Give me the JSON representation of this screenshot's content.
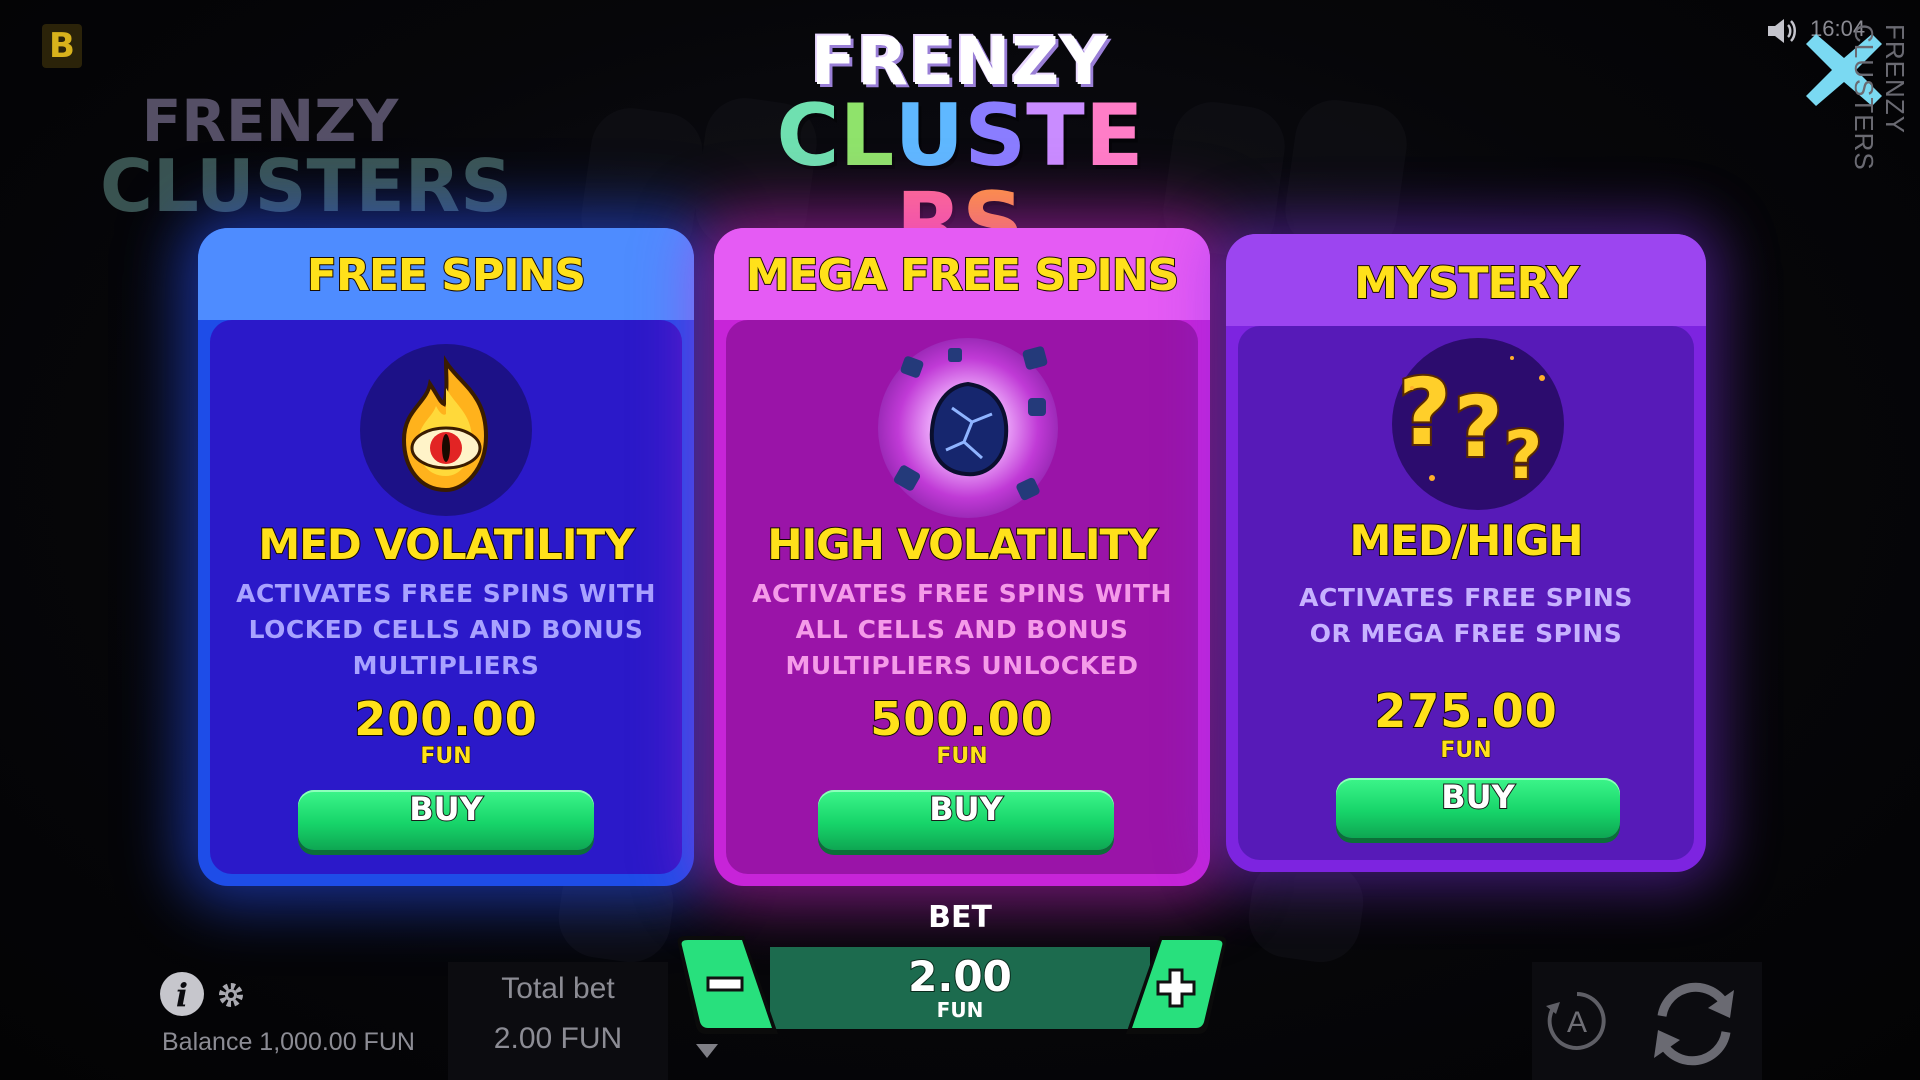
{
  "brand": {
    "logo_letter": "B"
  },
  "title": {
    "line1": "FRENZY",
    "line2": "CLUSTERS"
  },
  "status": {
    "time": "16:04",
    "side_title": "FRENZY CLUSTERS"
  },
  "cards": [
    {
      "header": "FREE SPINS",
      "volatility": "MED VOLATILITY",
      "description": "ACTIVATES FREE SPINS WITH LOCKED CELLS AND BONUS MULTIPLIERS",
      "price": "200.00",
      "currency": "FUN",
      "buy_label": "BUY",
      "colors": {
        "header": "#4e8cff",
        "border": "#1e4de8",
        "body": "#2b19c9",
        "text": "#a8a2ff"
      }
    },
    {
      "header": "MEGA FREE SPINS",
      "volatility": "HIGH VOLATILITY",
      "description": "ACTIVATES FREE SPINS WITH ALL CELLS AND BONUS MULTIPLIERS UNLOCKED",
      "price": "500.00",
      "currency": "FUN",
      "buy_label": "BUY",
      "colors": {
        "header": "#e55bf4",
        "border": "#c724d8",
        "body": "#9a14a8",
        "text": "#f59be9"
      }
    },
    {
      "header": "MYSTERY",
      "volatility": "MED/HIGH",
      "description": "ACTIVATES FREE SPINS OR MEGA FREE SPINS",
      "price": "275.00",
      "currency": "FUN",
      "buy_label": "BUY",
      "colors": {
        "header": "#9c45f0",
        "border": "#7d24e0",
        "body": "#571ab8",
        "text": "#c7b2ff"
      }
    }
  ],
  "bet": {
    "label": "BET",
    "value": "2.00",
    "currency": "FUN",
    "minus": "−",
    "plus": "+"
  },
  "footer": {
    "balance": "Balance 1,000.00 FUN",
    "total_bet_label": "Total bet",
    "total_bet_value": "2.00 FUN",
    "autoplay_letter": "A"
  },
  "icons": [
    "speaker-icon",
    "close-icon",
    "info-icon",
    "gear-icon",
    "fire-eye-icon",
    "crystal-orb-icon",
    "question-marks-icon",
    "autoplay-icon",
    "spin-icon"
  ]
}
